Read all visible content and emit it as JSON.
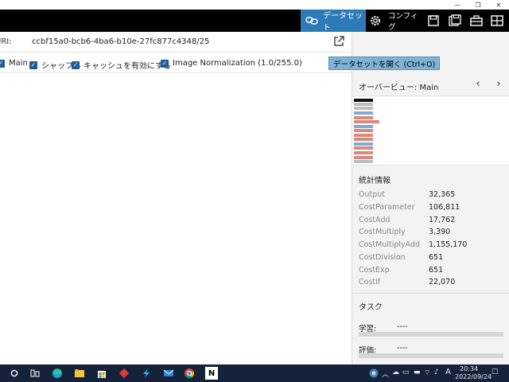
{
  "window": {
    "minimize_glyph": "—",
    "maximize_glyph": "❐",
    "close_glyph": "✕"
  },
  "toolbar": {
    "dataset_label": "データセット",
    "config_label": "コンフィグ",
    "accent_color": "#2c7bb6"
  },
  "uri": {
    "label": "URI:",
    "value": "ccbf15a0-bcb6-4ba6-b10e-27fc877c4348/25"
  },
  "options": {
    "main": "Main",
    "shuffle": "シャッフル",
    "cache": "キャッシュを有効にする",
    "normalization": "Image Normalization (1.0/255.0)"
  },
  "tooltip": "データセットを開く (Ctrl+O)",
  "overview": {
    "title": "オーバービュー: Main",
    "prev_glyph": "‹",
    "next_glyph": "›"
  },
  "stats": {
    "title": "統計情報",
    "rows": [
      {
        "name": "Output",
        "value": "32,365"
      },
      {
        "name": "CostParameter",
        "value": "106,811"
      },
      {
        "name": "CostAdd",
        "value": "17,762"
      },
      {
        "name": "CostMultiply",
        "value": "3,390"
      },
      {
        "name": "CostMultiplyAdd",
        "value": "1,155,170"
      },
      {
        "name": "CostDivision",
        "value": "651"
      },
      {
        "name": "CostExp",
        "value": "651"
      },
      {
        "name": "CostIf",
        "value": "22,070"
      }
    ]
  },
  "tasks": {
    "title": "タスク",
    "learning_label": "学習:",
    "learning_value": "----",
    "evaluation_label": "評価:",
    "evaluation_value": "----"
  },
  "taskbar": {
    "time": "20:34",
    "date": "2022/09/24",
    "ime": "A",
    "app_label": "N"
  }
}
